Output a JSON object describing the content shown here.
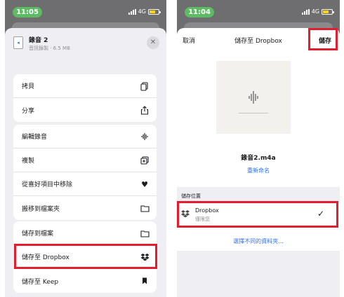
{
  "left": {
    "time": "11:05",
    "network": "4G",
    "file": {
      "name": "錄音 2",
      "subtitle": "音訊錄製 · 6.5 MB",
      "icon": "audio-file-icon"
    },
    "group1": [
      {
        "label": "拷貝",
        "icon": "copy-icon"
      },
      {
        "label": "分享",
        "icon": "share-icon"
      }
    ],
    "group2": [
      {
        "label": "編輯錄音",
        "icon": "waveform-icon"
      },
      {
        "label": "複製",
        "icon": "duplicate-icon"
      },
      {
        "label": "從喜好項目中移除",
        "icon": "heart-icon"
      },
      {
        "label": "搬移到檔案夾",
        "icon": "folder-icon"
      }
    ],
    "group3": [
      {
        "label": "儲存到檔案",
        "icon": "folder-icon"
      },
      {
        "label": "儲存至 Dropbox",
        "icon": "dropbox-icon"
      },
      {
        "label": "儲存至 Keep",
        "icon": "bookmark-icon"
      }
    ]
  },
  "right": {
    "time": "11:04",
    "network": "4G",
    "nav": {
      "cancel": "取消",
      "title": "儲存至 Dropbox",
      "save": "儲存"
    },
    "file_name": "錄音2.m4a",
    "rename": "重新命名",
    "location_label": "儲存位置",
    "location": {
      "name": "Dropbox",
      "sub": "僅限您"
    },
    "choose_folder": "選擇不同的資料夾..."
  },
  "colors": {
    "highlight": "#e11d2e",
    "link": "#2f6fed",
    "status_pill": "#5dbb63"
  }
}
